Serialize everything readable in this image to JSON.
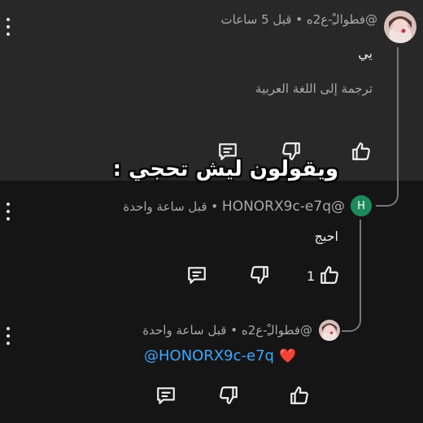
{
  "comments": [
    {
      "author": "@فطوالـِْ-ع2ه",
      "separator": "•",
      "time": "قبل 5 ساعات",
      "text": "يي",
      "translate": "ترجمة إلى اللغة العربية"
    },
    {
      "avatar_letter": "H",
      "author": "@HONORX9c-e7q",
      "separator": "•",
      "time": "قبل ساعة واحدة",
      "text": "احبج",
      "like_count": "1"
    },
    {
      "author": "@فطوالـِْ-ع2ه",
      "separator": "•",
      "time": "قبل ساعة واحدة",
      "heart": "❤️",
      "mention": "@HONORX9c-e7q"
    }
  ],
  "overlay_caption": "ويقولون ليش تحجي :",
  "colors": {
    "top_background": "#282828",
    "bottom_background": "#151515",
    "avatar_h": "#1e8a5a",
    "mention": "#3ea6ff"
  },
  "icons": [
    "kebab-menu-icon",
    "like-icon",
    "dislike-icon",
    "reply-icon"
  ]
}
